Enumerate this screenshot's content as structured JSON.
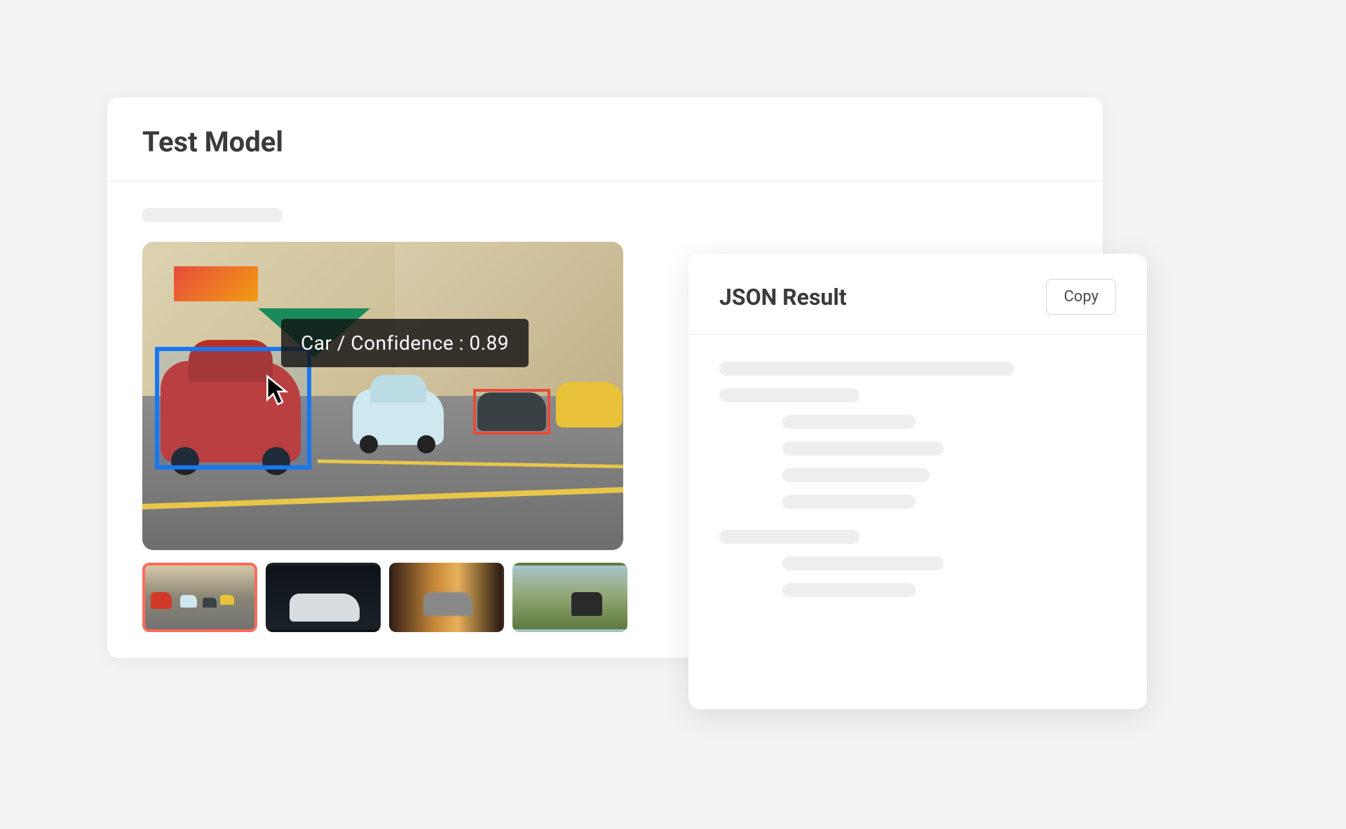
{
  "testModel": {
    "title": "Test Model",
    "detection": {
      "label": "Car / Confidence : 0.89"
    },
    "thumbnails": [
      {
        "name": "thumb-street-cars",
        "selected": true
      },
      {
        "name": "thumb-white-car-dark",
        "selected": false
      },
      {
        "name": "thumb-motion-blur-car",
        "selected": false
      },
      {
        "name": "thumb-offroad-landscape",
        "selected": false
      }
    ]
  },
  "jsonResult": {
    "title": "JSON Result",
    "copyLabel": "Copy"
  }
}
